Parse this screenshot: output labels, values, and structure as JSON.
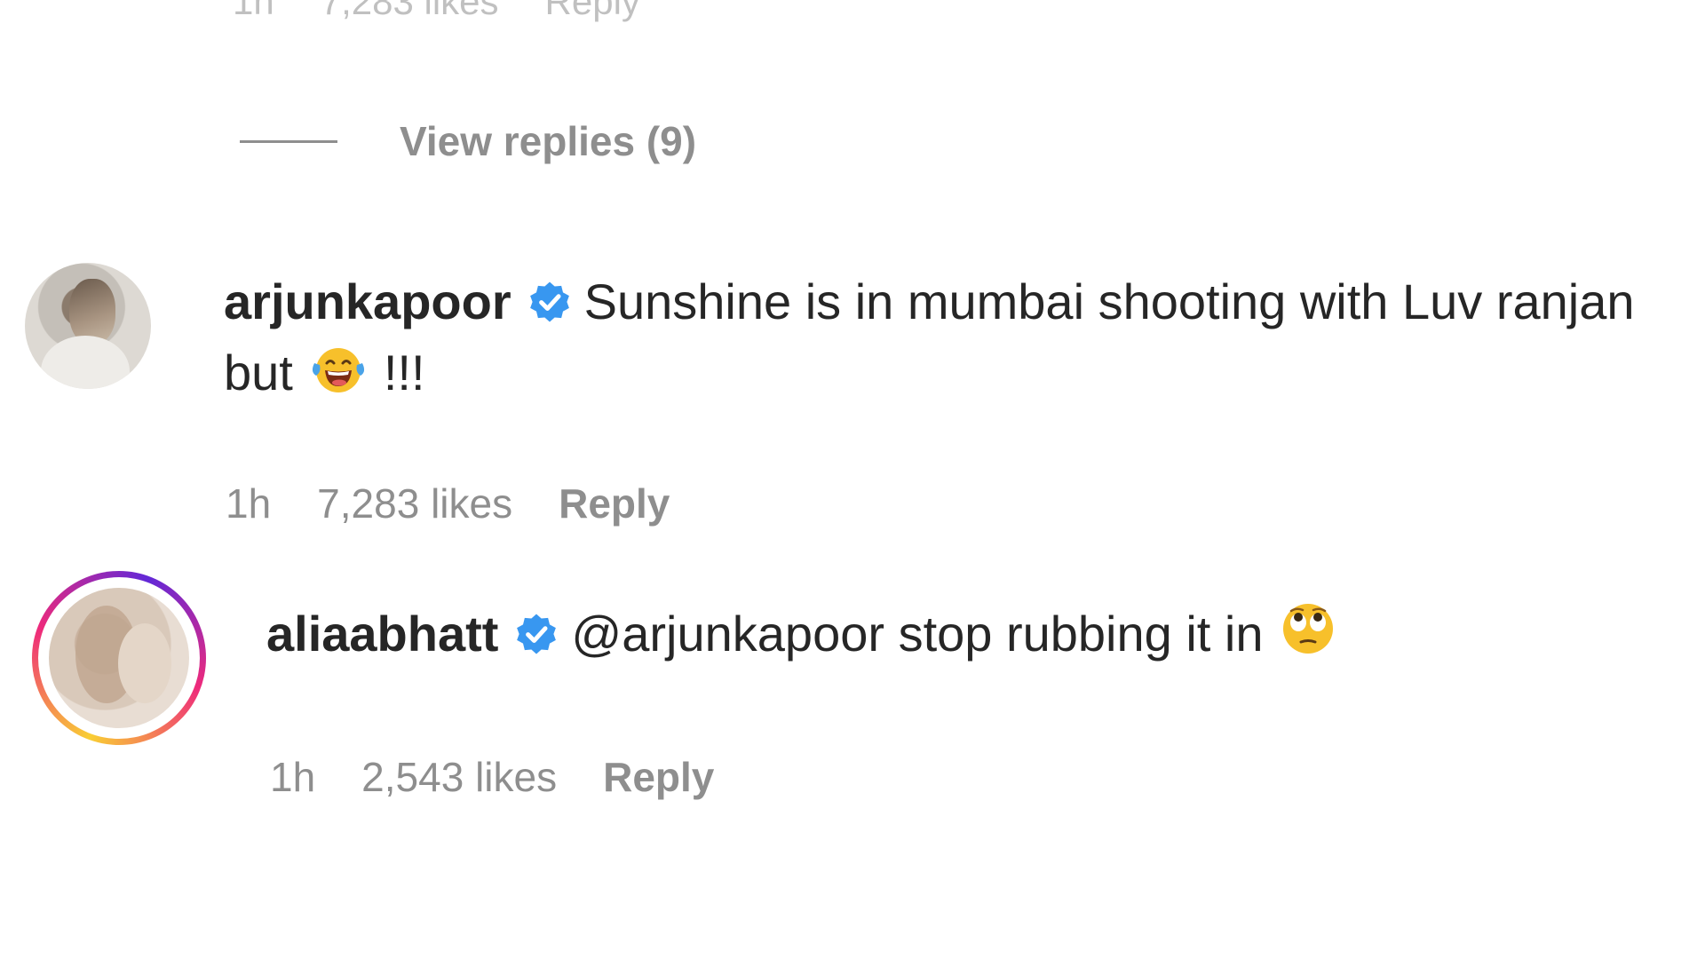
{
  "previous_comment": {
    "time": "1h",
    "likes": "7,283 likes",
    "reply_label": "Reply"
  },
  "view_replies": {
    "label": "View replies (9)"
  },
  "comments": [
    {
      "username": "arjunkapoor",
      "text_part1": "Sunshine is in mumbai shooting with Luv ranjan but",
      "emoji_icon": "tears-of-joy-emoji-icon",
      "text_part2": "!!!",
      "time": "1h",
      "likes": "7,283 likes",
      "reply_label": "Reply"
    },
    {
      "username": "aliaabhatt",
      "text": "@arjunkapoor stop rubbing it in",
      "emoji_icon": "eye-roll-emoji-icon",
      "time": "1h",
      "likes": "2,543 likes",
      "reply_label": "Reply"
    }
  ],
  "colors": {
    "text": "#262626",
    "secondary_text": "#8e8e8e",
    "verified_blue": "#3897f0"
  }
}
